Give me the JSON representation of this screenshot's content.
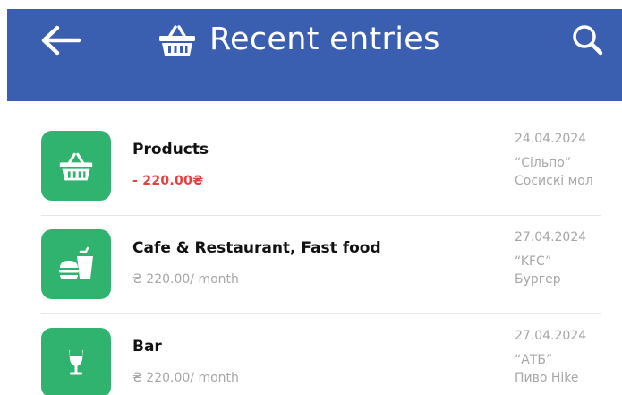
{
  "header": {
    "title": "Recent entries",
    "background_color": "#3a5fb0",
    "back_icon": "arrow-left-icon",
    "title_icon": "basket-icon",
    "search_icon": "search-icon"
  },
  "entries": [
    {
      "category": "Products",
      "amount": "- 220.00₴",
      "amount_style": "expense",
      "date": "24.04.2024",
      "store": "“Сільпо”",
      "note": "Сосискі мол",
      "icon": "basket-icon",
      "icon_color": "#2fb36e"
    },
    {
      "category": "Cafe & Restaurant, Fast food",
      "amount": "₴ 220.00/ month",
      "amount_style": "recurring",
      "date": "27.04.2024",
      "store": "“KFC”",
      "note": "Бургер",
      "icon": "burger-drink-icon",
      "icon_color": "#2fb36e"
    },
    {
      "category": "Bar",
      "amount": "₴ 220.00/ month",
      "amount_style": "recurring",
      "date": "27.04.2024",
      "store": "“АТБ”",
      "note": "Пиво Hike",
      "icon": "wine-glass-icon",
      "icon_color": "#2fb36e"
    }
  ],
  "colors": {
    "expense": "#e8403f",
    "muted_text": "#a7a7a7",
    "divider": "#e6e6e6"
  }
}
